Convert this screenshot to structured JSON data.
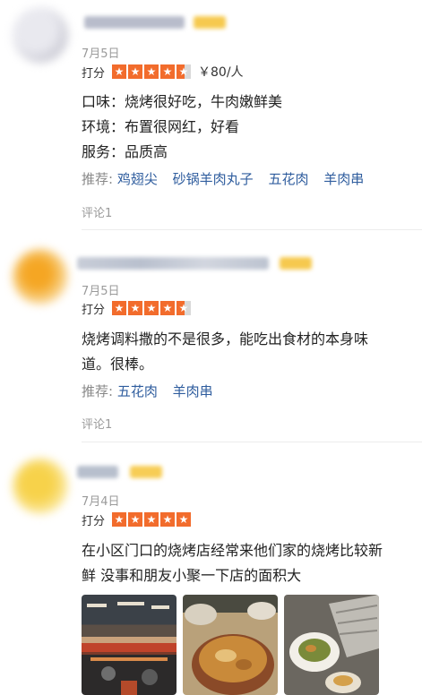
{
  "reviews": [
    {
      "date": "7月5日",
      "rating_label": "打分",
      "price": "￥80/人",
      "lines": [
        "口味：烧烤很好吃，牛肉嫩鲜美",
        "环境：布置很网红，好看",
        "服务：品质高"
      ],
      "recommend_label": "推荐:",
      "dishes": [
        "鸡翅尖",
        "砂锅羊肉丸子",
        "五花肉",
        "羊肉串"
      ],
      "comments": "评论1",
      "stars": 4.5
    },
    {
      "date": "7月5日",
      "rating_label": "打分",
      "lines": [
        "烧烤调料撒的不是很多，能吃出食材的本身味",
        "道。很棒。"
      ],
      "recommend_label": "推荐:",
      "dishes": [
        "五花肉",
        "羊肉串"
      ],
      "comments": "评论1",
      "stars": 4.5
    },
    {
      "date": "7月4日",
      "rating_label": "打分",
      "lines": [
        "在小区门口的烧烤店经常来他们家的烧烤比较新",
        "鲜 没事和朋友小聚一下店的面积大"
      ],
      "stars": 5
    }
  ],
  "colors": {
    "star": "#f26c2c",
    "link": "#2f5d9e",
    "muted": "#9a9a9a"
  }
}
